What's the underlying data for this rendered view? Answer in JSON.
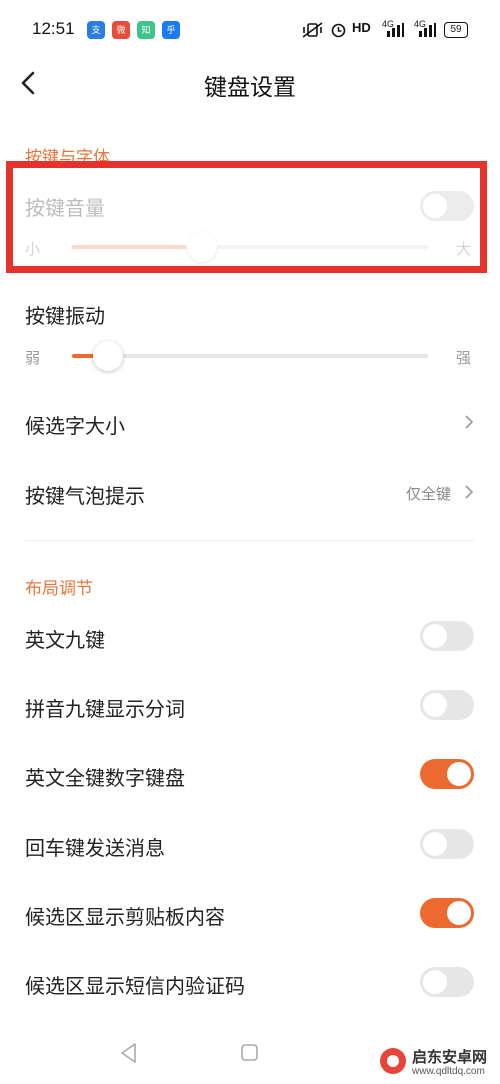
{
  "status_bar": {
    "time": "12:51",
    "network": "HD",
    "signal_1": "4G",
    "signal_2": "4G",
    "battery": "59"
  },
  "header": {
    "title": "键盘设置"
  },
  "section_keys": {
    "title": "按键与字体",
    "key_volume": {
      "label": "按键音量",
      "toggle_on": false,
      "min_label": "小",
      "max_label": "大",
      "level": 0.32
    },
    "key_vibration": {
      "label": "按键振动",
      "min_label": "弱",
      "max_label": "强",
      "level": 0.1
    },
    "candidate_font_size": {
      "label": "候选字大小"
    },
    "key_bubble": {
      "label": "按键气泡提示",
      "value": "仅全键"
    }
  },
  "section_layout": {
    "title": "布局调节",
    "items": [
      {
        "label": "英文九键",
        "on": false
      },
      {
        "label": "拼音九键显示分词",
        "on": false
      },
      {
        "label": "英文全键数字键盘",
        "on": true
      },
      {
        "label": "回车键发送消息",
        "on": false
      },
      {
        "label": "候选区显示剪贴板内容",
        "on": true
      },
      {
        "label": "候选区显示短信内验证码",
        "on": false
      }
    ]
  },
  "watermark": {
    "name": "启东安卓网",
    "url": "www.qdltdq.com"
  },
  "colors": {
    "accent": "#ec6a2f",
    "highlight_box": "#e5322d"
  }
}
